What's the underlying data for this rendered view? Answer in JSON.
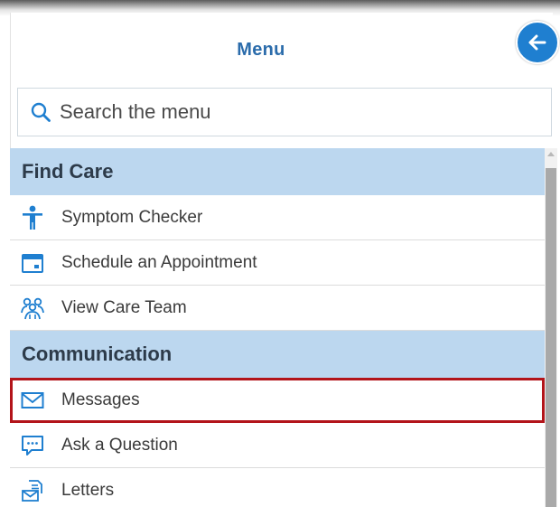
{
  "menu": {
    "title": "Menu",
    "back_icon": "arrow-left-icon"
  },
  "search": {
    "placeholder": "Search the menu",
    "value": "",
    "icon": "search-icon"
  },
  "sections": [
    {
      "title": "Find Care",
      "items": [
        {
          "label": "Symptom Checker",
          "icon": "person-accessibility-icon"
        },
        {
          "label": "Schedule an Appointment",
          "icon": "calendar-icon"
        },
        {
          "label": "View Care Team",
          "icon": "care-team-icon"
        }
      ]
    },
    {
      "title": "Communication",
      "items": [
        {
          "label": "Messages",
          "icon": "envelope-icon",
          "highlighted": true
        },
        {
          "label": "Ask a Question",
          "icon": "chat-bubble-icon"
        },
        {
          "label": "Letters",
          "icon": "letter-document-icon"
        }
      ]
    }
  ],
  "colors": {
    "accent": "#1f7fd0",
    "title": "#2b6cab",
    "section_header_bg": "#bcd7ef",
    "highlight_outline": "#b3141a"
  }
}
